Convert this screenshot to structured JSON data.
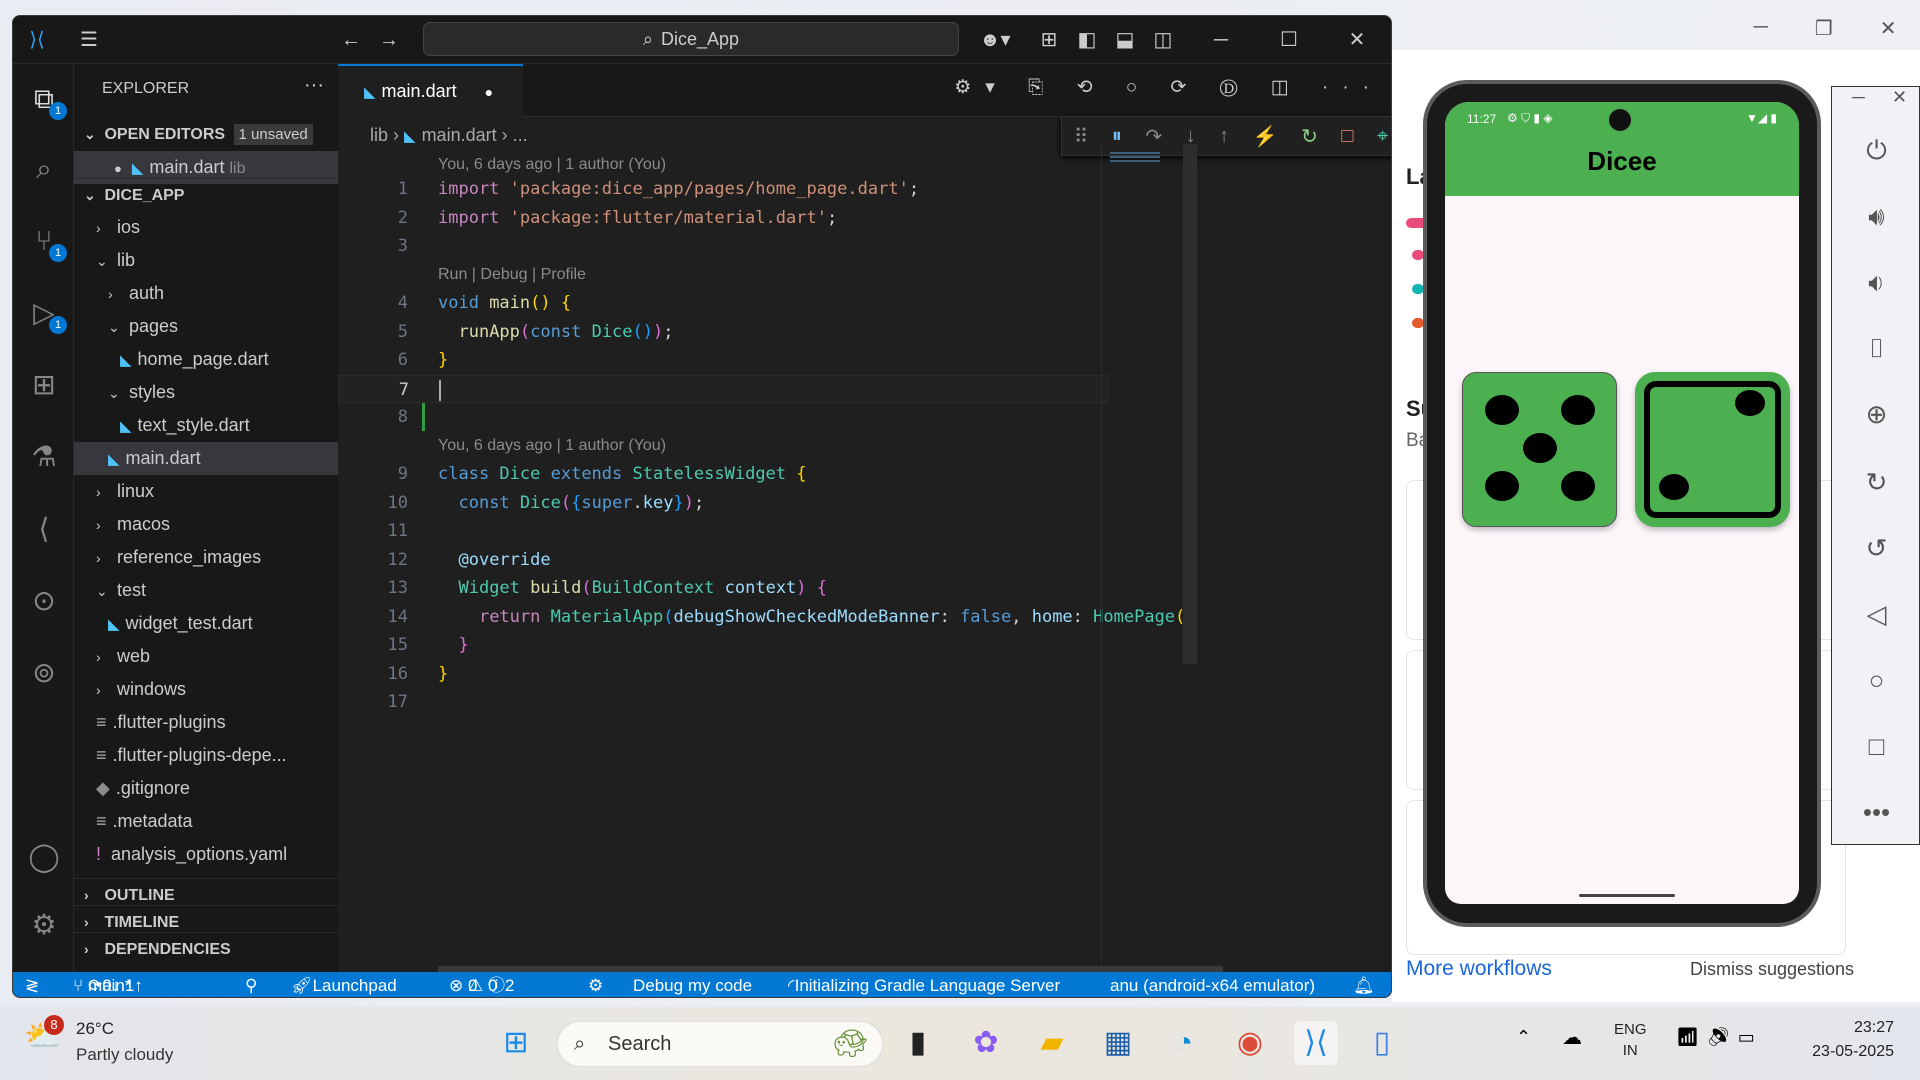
{
  "title_bar": {
    "search": "Dice_App"
  },
  "explorer": {
    "title": "EXPLORER",
    "open_editors": "OPEN EDITORS",
    "unsaved": "1 unsaved",
    "open_file": "main.dart",
    "open_file_dir": "lib",
    "project": "DICE_APP",
    "tree": [
      {
        "label": "ios",
        "type": "folder",
        "open": false,
        "depth": 1
      },
      {
        "label": "lib",
        "type": "folder",
        "open": true,
        "depth": 1
      },
      {
        "label": "auth",
        "type": "folder",
        "open": false,
        "depth": 2
      },
      {
        "label": "pages",
        "type": "folder",
        "open": true,
        "depth": 2
      },
      {
        "label": "home_page.dart",
        "type": "dart",
        "depth": 3
      },
      {
        "label": "styles",
        "type": "folder",
        "open": true,
        "depth": 2
      },
      {
        "label": "text_style.dart",
        "type": "dart",
        "depth": 3
      },
      {
        "label": "main.dart",
        "type": "dart",
        "depth": 2,
        "selected": true
      },
      {
        "label": "linux",
        "type": "folder",
        "open": false,
        "depth": 1
      },
      {
        "label": "macos",
        "type": "folder",
        "open": false,
        "depth": 1
      },
      {
        "label": "reference_images",
        "type": "folder",
        "open": false,
        "depth": 1
      },
      {
        "label": "test",
        "type": "folder",
        "open": true,
        "depth": 1
      },
      {
        "label": "widget_test.dart",
        "type": "dart",
        "depth": 2
      },
      {
        "label": "web",
        "type": "folder",
        "open": false,
        "depth": 1
      },
      {
        "label": "windows",
        "type": "folder",
        "open": false,
        "depth": 1
      },
      {
        "label": ".flutter-plugins",
        "type": "file",
        "depth": 1
      },
      {
        "label": ".flutter-plugins-depe...",
        "type": "file",
        "depth": 1
      },
      {
        "label": ".gitignore",
        "type": "git",
        "depth": 1
      },
      {
        "label": ".metadata",
        "type": "file",
        "depth": 1
      },
      {
        "label": "analysis_options.yaml",
        "type": "yaml",
        "depth": 1
      }
    ],
    "outline": "OUTLINE",
    "timeline": "TIMELINE",
    "dependencies": "DEPENDENCIES"
  },
  "editor": {
    "tab": "main.dart",
    "breadcrumb": [
      "lib",
      "main.dart",
      "..."
    ],
    "rows": [
      {
        "n": "1",
        "t": [
          [
            "kc",
            "import "
          ],
          [
            "str",
            "'package:dice_app/pages/home_page.dart'"
          ],
          [
            "pl",
            ";"
          ]
        ]
      },
      {
        "n": "2",
        "t": [
          [
            "kc",
            "import "
          ],
          [
            "str",
            "'package:flutter/material.dart'"
          ],
          [
            "pl",
            ";"
          ]
        ]
      },
      {
        "n": "3",
        "t": []
      },
      {
        "lens": "Run | Debug | Profile"
      },
      {
        "n": "4",
        "t": [
          [
            "kw",
            "void "
          ],
          [
            "fn",
            "main"
          ],
          [
            "p1",
            "() {"
          ]
        ]
      },
      {
        "n": "5",
        "t": [
          [
            "pl",
            "  "
          ],
          [
            "fn",
            "runApp"
          ],
          [
            "p2",
            "("
          ],
          [
            "kw",
            "const "
          ],
          [
            "ty",
            "Dice"
          ],
          [
            "p3",
            "()"
          ],
          [
            "p2",
            ")"
          ],
          [
            "pl",
            ";"
          ]
        ]
      },
      {
        "n": "6",
        "t": [
          [
            "p1",
            "}"
          ]
        ]
      },
      {
        "n": "7",
        "t": [],
        "cur": true
      },
      {
        "n": "8",
        "t": []
      },
      {
        "lens": "You, 6 days ago | 1 author (You)"
      },
      {
        "n": "9",
        "t": [
          [
            "kw",
            "class "
          ],
          [
            "ty",
            "Dice "
          ],
          [
            "kw",
            "extends "
          ],
          [
            "ty",
            "StatelessWidget "
          ],
          [
            "p1",
            "{"
          ]
        ]
      },
      {
        "n": "10",
        "t": [
          [
            "pl",
            "  "
          ],
          [
            "kw",
            "const "
          ],
          [
            "ty",
            "Dice"
          ],
          [
            "p2",
            "("
          ],
          [
            "p3",
            "{"
          ],
          [
            "kw",
            "super"
          ],
          [
            "pl",
            "."
          ],
          [
            "va",
            "key"
          ],
          [
            "p3",
            "}"
          ],
          [
            "p2",
            ")"
          ],
          [
            "pl",
            ";"
          ]
        ]
      },
      {
        "n": "11",
        "t": []
      },
      {
        "n": "12",
        "t": [
          [
            "pl",
            "  "
          ],
          [
            "va",
            "@override"
          ]
        ]
      },
      {
        "n": "13",
        "t": [
          [
            "pl",
            "  "
          ],
          [
            "ty",
            "Widget "
          ],
          [
            "fn",
            "build"
          ],
          [
            "p2",
            "("
          ],
          [
            "ty",
            "BuildContext "
          ],
          [
            "va",
            "context"
          ],
          [
            "p2",
            ") {"
          ]
        ]
      },
      {
        "n": "14",
        "t": [
          [
            "pl",
            "    "
          ],
          [
            "kc",
            "return "
          ],
          [
            "ty",
            "MaterialApp"
          ],
          [
            "p3",
            "("
          ],
          [
            "va",
            "debugShowCheckedModeBanner"
          ],
          [
            "pl",
            ": "
          ],
          [
            "kw",
            "false"
          ],
          [
            "pl",
            ", "
          ],
          [
            "va",
            "home"
          ],
          [
            "pl",
            ": "
          ],
          [
            "ty",
            "HomePage"
          ],
          [
            "p1",
            "()"
          ]
        ]
      },
      {
        "n": "15",
        "t": [
          [
            "pl",
            "  "
          ],
          [
            "p2",
            "}"
          ]
        ]
      },
      {
        "n": "16",
        "t": [
          [
            "p1",
            "}"
          ]
        ]
      },
      {
        "n": "17",
        "t": []
      }
    ],
    "top_lens": "You, 6 days ago | 1 author (You)"
  },
  "status": {
    "branch": "main*",
    "sync": "0↓ 1↑",
    "launchpad": "Launchpad",
    "errors": "0",
    "warnings": "0",
    "infos": "2",
    "debug": "Debug my code",
    "init": "Initializing Gradle Language Server",
    "device": "anu (android-x64 emulator)"
  },
  "phone": {
    "time": "11:27",
    "app_title": "Dicee",
    "left_die": 5,
    "right_die": 2
  },
  "background_app": {
    "heading1": "La",
    "heading2": "Su",
    "sub": "Ba",
    "more": "More workflows",
    "dismiss": "Dismiss suggestions"
  },
  "taskbar": {
    "temp": "26°C",
    "weather": "Partly cloudy",
    "weather_badge": "8",
    "search": "Search",
    "lang1": "ENG",
    "lang2": "IN",
    "time": "23:27",
    "date": "23-05-2025"
  },
  "colors": {
    "accent": "#0078d4",
    "app_green": "#4caf50"
  }
}
